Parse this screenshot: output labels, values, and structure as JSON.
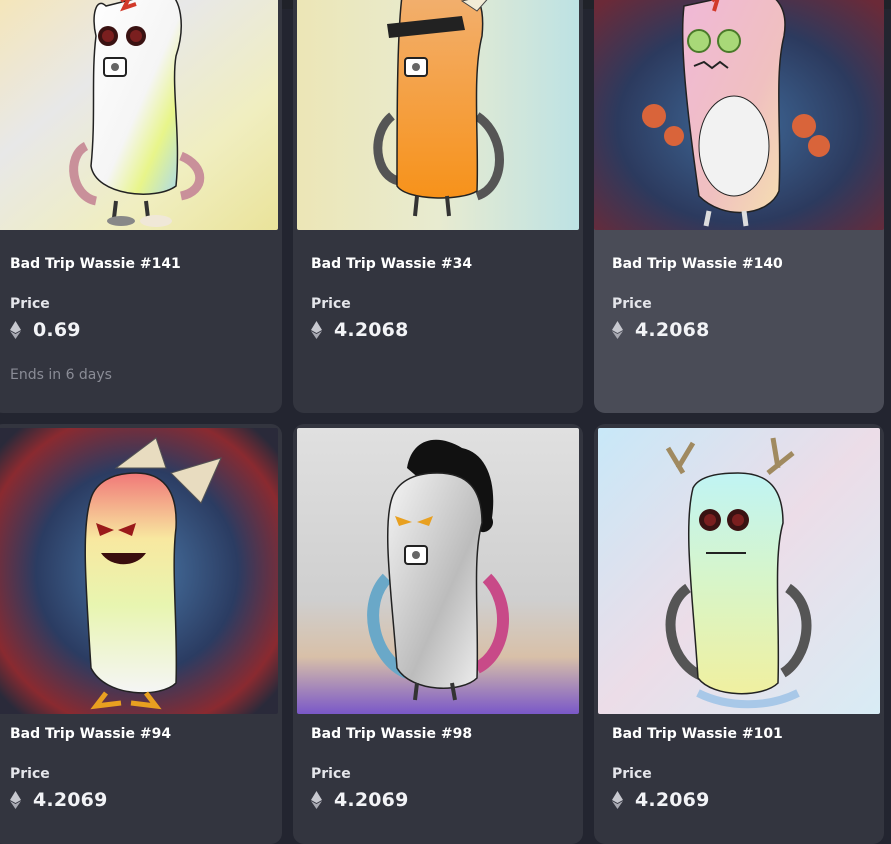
{
  "colors": {
    "page_bg": "#232530",
    "card_bg": "#33353f",
    "card_hover_bg": "#4a4c57",
    "text": "#ffffff",
    "muted": "#8a8c96"
  },
  "price_label": "Price",
  "currency_icon": "ethereum-icon",
  "cards": [
    {
      "name": "Bad Trip Wassie #141",
      "price": "0.69",
      "status": "Ends in 6 days"
    },
    {
      "name": "Bad Trip Wassie #34",
      "price": "4.2068"
    },
    {
      "name": "Bad Trip Wassie #140",
      "price": "4.2068"
    },
    {
      "name": "Bad Trip Wassie #94",
      "price": "4.2069"
    },
    {
      "name": "Bad Trip Wassie #98",
      "price": "4.2069"
    },
    {
      "name": "Bad Trip Wassie #101",
      "price": "4.2069"
    }
  ]
}
